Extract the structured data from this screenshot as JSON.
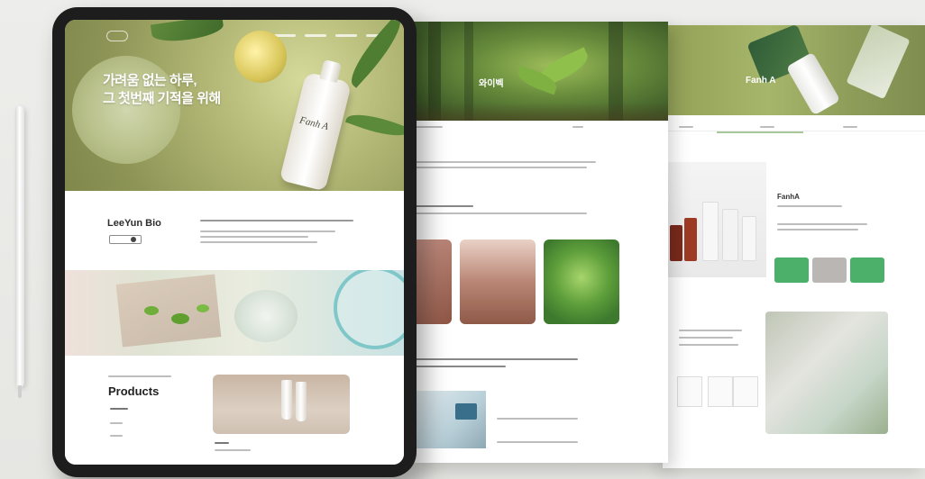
{
  "tablet": {
    "hero_title_line1": "가려움 없는 하루,",
    "hero_title_line2": "그 첫번째 기적을 위해",
    "hero_subtitle": "",
    "bottle_label": "Fanh A",
    "brand_name": "LeeYun Bio",
    "products_title": "Products"
  },
  "page_middle": {
    "hero_title": "와이벡"
  },
  "page_right": {
    "hero_title": "Fanh A",
    "product_name": "FanhA"
  },
  "colors": {
    "accent_green": "#4caf6a",
    "muted_grey": "#b9b6b4",
    "hero_olive": "#8d9456"
  },
  "icons": [
    "logo-icon",
    "pencil-icon"
  ]
}
